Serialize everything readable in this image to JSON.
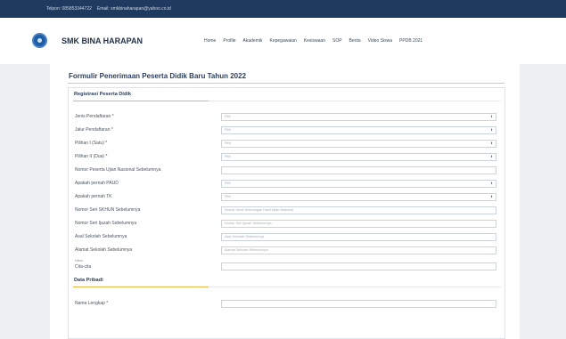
{
  "topbar": {
    "phone": "Telpon: 085853344722",
    "email": "Email: smkbinaharapan@yahoo.co.id"
  },
  "header": {
    "brand": "SMK BINA HARAPAN",
    "nav": [
      "Home",
      "Profile",
      "Akademik",
      "Kepegawaian",
      "Kesiswaan",
      "SOP",
      "Berita",
      "Video Siswa",
      "PPDB 2021"
    ]
  },
  "page": {
    "title": "Formulir Penerimaan Peserta Didik Baru Tahun 2022"
  },
  "sections": {
    "registrasi": "Registrasi Peserta Didik",
    "pribadi": "Data Pribadi"
  },
  "fields": [
    {
      "label": "Jenis Pendaftaran *",
      "type": "select",
      "value": "Pilih"
    },
    {
      "label": "Jalur Pendaftaran *",
      "type": "select",
      "value": "Pilih"
    },
    {
      "label": "Pilihan I (Satu) *",
      "type": "select",
      "value": "Pilih"
    },
    {
      "label": "Pilihan II (Dua) *",
      "type": "select",
      "value": "Pilih"
    },
    {
      "label": "Nomor Peserta Ujian Nasional Sebelumnya",
      "type": "text",
      "value": ""
    },
    {
      "label": "Apakah pernah PAUD",
      "type": "select",
      "value": "Pilih"
    },
    {
      "label": "Apakah pernah TK",
      "type": "select",
      "value": "Pilih"
    },
    {
      "label": "Nomor Seri SKHUN Sebelumnya",
      "type": "text",
      "placeholder": "Nomor Surat Keterangan Hasil Ujian Nasional"
    },
    {
      "label": "Nomor Seri Ijazah Sebelumnya",
      "type": "text",
      "placeholder": "Nomor Seri Ijazah Sebelumnya"
    },
    {
      "label": "Asal Sekolah Sebelumnya",
      "type": "text",
      "placeholder": "Asal Sekolah Sebelumnya"
    },
    {
      "label": "Alamat Sekolah Sebelumnya",
      "type": "text",
      "placeholder": "Alamat Sekolah Sebelumnya"
    },
    {
      "label": "Cita-cita",
      "sublabel": "Isikan",
      "type": "text",
      "value": ""
    },
    {
      "label": "Nama Lengkap *",
      "type": "text",
      "value": ""
    }
  ]
}
